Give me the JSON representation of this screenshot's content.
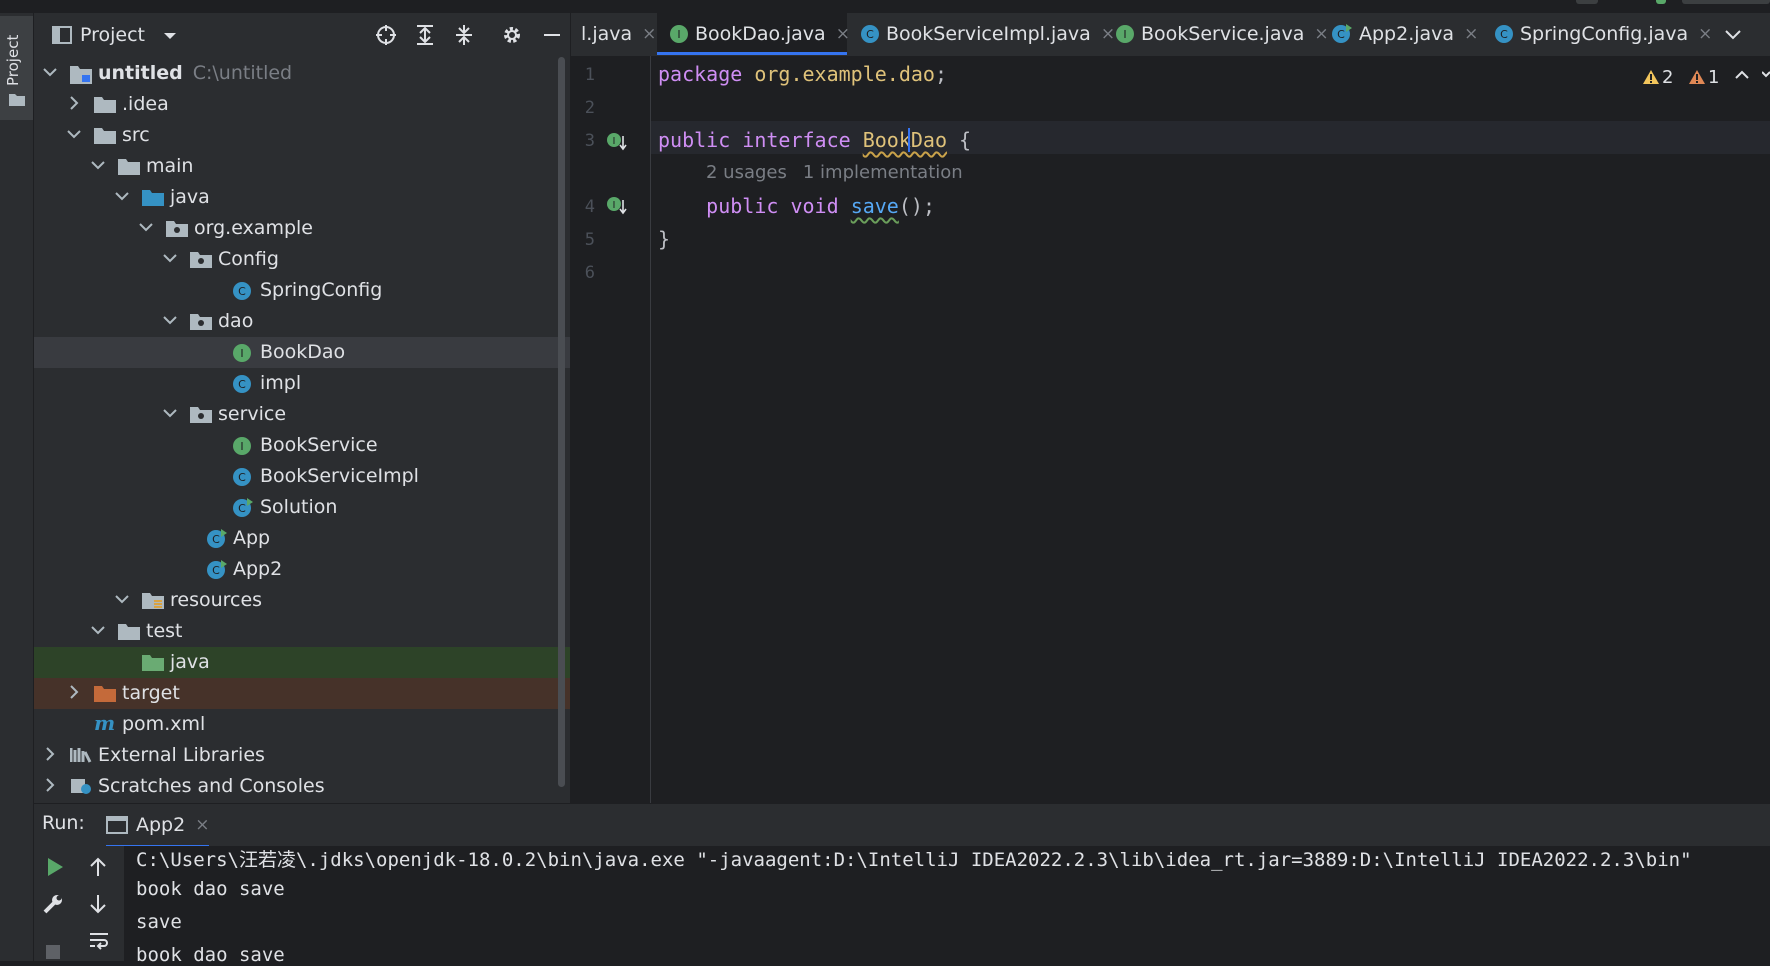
{
  "project_panel": {
    "title": "Project",
    "tree": [
      {
        "label": "untitled",
        "hint": "C:\\untitled"
      },
      {
        "label": ".idea"
      },
      {
        "label": "src"
      },
      {
        "label": "main"
      },
      {
        "label": "java"
      },
      {
        "label": "org.example"
      },
      {
        "label": "Config"
      },
      {
        "label": "SpringConfig"
      },
      {
        "label": "dao"
      },
      {
        "label": "BookDao"
      },
      {
        "label": "impl"
      },
      {
        "label": "service"
      },
      {
        "label": "BookService"
      },
      {
        "label": "BookServiceImpl"
      },
      {
        "label": "Solution"
      },
      {
        "label": "App"
      },
      {
        "label": "App2"
      },
      {
        "label": "resources"
      },
      {
        "label": "test"
      },
      {
        "label": "java"
      },
      {
        "label": "target"
      },
      {
        "label": "pom.xml"
      },
      {
        "label": "External Libraries"
      },
      {
        "label": "Scratches and Consoles"
      }
    ]
  },
  "tool_stripe": {
    "project_label": "Project"
  },
  "editor": {
    "tabs": [
      {
        "label": "l.java"
      },
      {
        "label": "BookDao.java",
        "active": true
      },
      {
        "label": "BookServiceImpl.java"
      },
      {
        "label": "BookService.java"
      },
      {
        "label": "App2.java"
      },
      {
        "label": "SpringConfig.java"
      }
    ],
    "close_glyph": "×",
    "line_numbers": [
      "1",
      "2",
      "3",
      "4",
      "5",
      "6"
    ],
    "code": {
      "l1_kw": "package",
      "l1_pkg": "org.example.dao",
      "l1_end": ";",
      "l3_kw1": "public",
      "l3_kw2": "interface",
      "l3_name": "BookDao",
      "l3_end": " {",
      "l4_kw1": "public",
      "l4_kw2": "void",
      "l4_name": "save",
      "l4_end": "();",
      "l5": "}"
    },
    "inlay": {
      "usages": "2 usages",
      "implementations": "1 implementation"
    },
    "inspections": {
      "weak_warnings": "2",
      "warnings": "1"
    }
  },
  "run_panel": {
    "label": "Run:",
    "tab": "App2",
    "console_lines": [
      "C:\\Users\\汪若凌\\.jdks\\openjdk-18.0.2\\bin\\java.exe \"-javaagent:D:\\IntelliJ IDEA2022.2.3\\lib\\idea_rt.jar=3889:D:\\IntelliJ IDEA2022.2.3\\bin\"",
      "book dao save",
      "save",
      "book dao save"
    ]
  },
  "colors": {
    "accent": "#3574f0",
    "interface_icon": "#59a869",
    "class_icon": "#3592c4",
    "folder": "#aeb9c0",
    "excluded_folder": "#c46a3a",
    "test_folder": "#6aab73",
    "warning": "#f2c55c",
    "warning_strong": "#e08855"
  }
}
